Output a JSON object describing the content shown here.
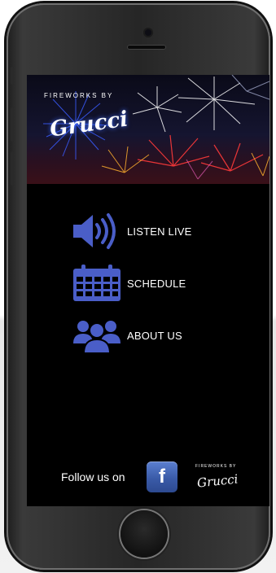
{
  "banner": {
    "brand_small": "FIREWORKS BY",
    "logo_text": "Grucci"
  },
  "menu": [
    {
      "label": "LISTEN LIVE",
      "icon": "speaker-icon"
    },
    {
      "label": "SCHEDULE",
      "icon": "calendar-icon"
    },
    {
      "label": "ABOUT US",
      "icon": "group-icon"
    }
  ],
  "footer": {
    "follow_label": "Follow us on",
    "facebook_glyph": "f",
    "brand_small": "FIREWORKS BY",
    "logo_text": "Grucci"
  },
  "colors": {
    "icon_blue": "#4a5ec8",
    "background": "#000000",
    "facebook_blue": "#3a5ba8"
  }
}
